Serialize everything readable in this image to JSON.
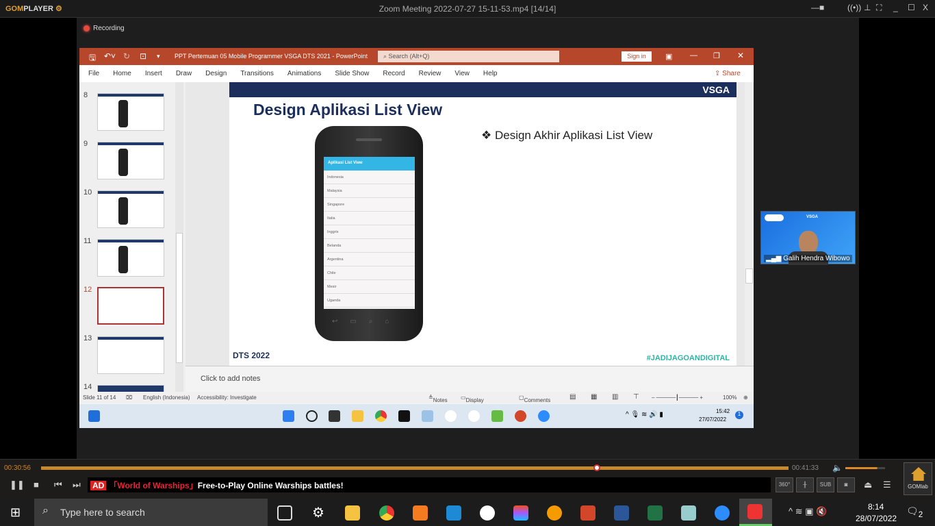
{
  "player": {
    "logo_a": "GOM",
    "logo_b": "PLAYER",
    "title": "Zoom Meeting 2022-07-27 15-11-53.mp4  [14/14]",
    "elapsed": "00:30:56",
    "total": "00:41:33",
    "progress": 0.744,
    "volume": 0.8,
    "ad_badge": "AD",
    "ad_title": "「World of Warships」",
    "ad_text": "Free-to-Play Online Warships battles!",
    "btn_360": "360°",
    "btn_sub": "SUB",
    "gomlab": "GOMlab"
  },
  "zoom": {
    "recording": "Recording",
    "participant": "Galih Hendra Wibowo"
  },
  "ppt": {
    "title": "PPT Pertemuan 05 Mobile Programmer VSGA DTS 2021  -  PowerPoint",
    "search": "Search (Alt+Q)",
    "sign_in": "Sign in",
    "share": "Share",
    "menu": [
      "File",
      "Home",
      "Insert",
      "Draw",
      "Design",
      "Transitions",
      "Animations",
      "Slide Show",
      "Record",
      "Review",
      "View",
      "Help"
    ],
    "thumbnails": [
      {
        "num": "8"
      },
      {
        "num": "9"
      },
      {
        "num": "10"
      },
      {
        "num": "11"
      },
      {
        "num": "12"
      },
      {
        "num": "13"
      },
      {
        "num": "14"
      }
    ],
    "slide": {
      "logo": "VSGA",
      "title": "Design Aplikasi List View",
      "bullet": "❖  Design Akhir Aplikasi List View",
      "app_header": "Aplikasi List View",
      "list": [
        "Indonesia",
        "Malaysia",
        "Singapore",
        "Italia",
        "Inggris",
        "Belanda",
        "Argentina",
        "Chile",
        "Mesir",
        "Uganda"
      ],
      "footer_left": "DTS 2022",
      "footer_right": "#JADIJAGOANDIGITAL"
    },
    "notes": "Click to add notes",
    "status": {
      "slide": "Slide 11 of 14",
      "language": "English (Indonesia)",
      "accessibility": "Accessibility: Investigate",
      "notes": "Notes",
      "display": "Display Settings",
      "comments": "Comments",
      "zoom": "100%"
    }
  },
  "inner_taskbar": {
    "time": "15:42",
    "date": "27/07/2022",
    "badge": "1"
  },
  "taskbar": {
    "search": "Type here to search",
    "time": "8:14",
    "date": "28/07/2022",
    "notif": "2"
  }
}
